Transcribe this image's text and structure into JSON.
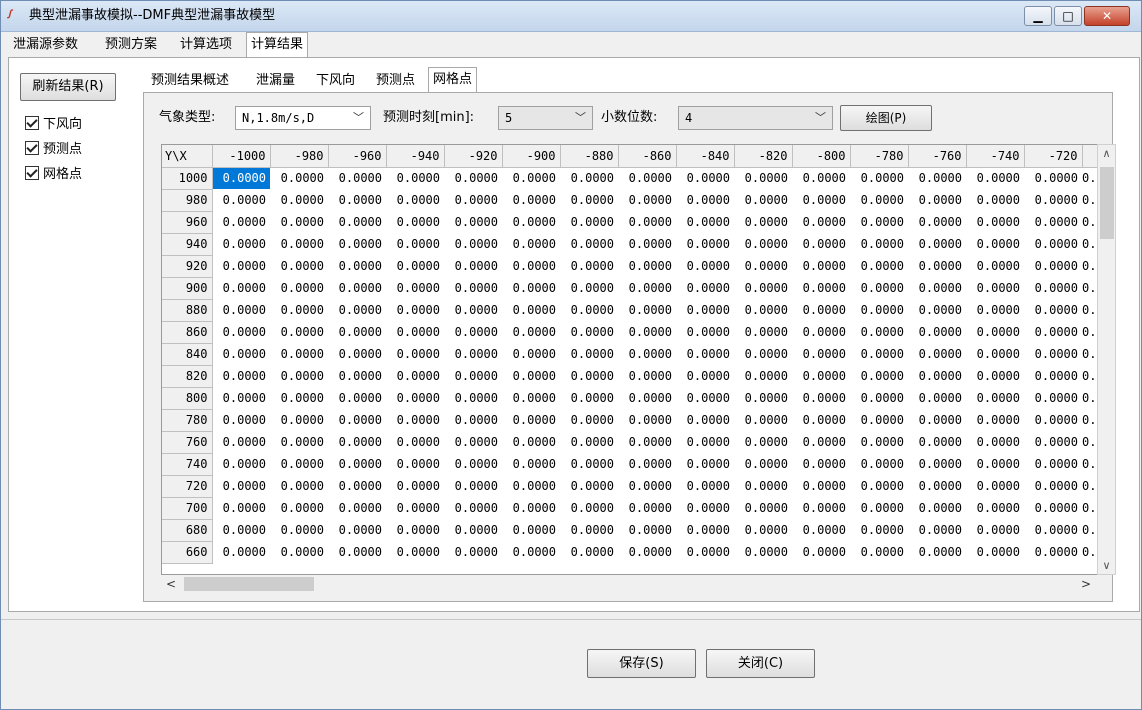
{
  "window": {
    "title": "典型泄漏事故模拟--DMF典型泄漏事故模型",
    "icon": "app-logo-icon",
    "controls": [
      "minimize-icon",
      "maximize-icon",
      "close-icon"
    ]
  },
  "top_tabs": [
    {
      "label": "泄漏源参数",
      "active": false
    },
    {
      "label": "预测方案",
      "active": false
    },
    {
      "label": "计算选项",
      "active": false
    },
    {
      "label": "计算结果",
      "active": true
    }
  ],
  "sidebar": {
    "refresh_label": "刷新结果(R)",
    "checkboxes": [
      {
        "label": "下风向",
        "checked": true
      },
      {
        "label": "预测点",
        "checked": true
      },
      {
        "label": "网格点",
        "checked": true
      }
    ]
  },
  "sub_tabs": [
    {
      "label": "预测结果概述",
      "active": false
    },
    {
      "label": "泄漏量",
      "active": false
    },
    {
      "label": "下风向",
      "active": false
    },
    {
      "label": "预测点",
      "active": false
    },
    {
      "label": "网格点",
      "active": true
    }
  ],
  "controls": {
    "weather_label": "气象类型:",
    "weather_value": "N,1.8m/s,D",
    "time_label": "预测时刻[min]:",
    "time_value": "5",
    "decimals_label": "小数位数:",
    "decimals_value": "4",
    "draw_label": "绘图(P)"
  },
  "grid": {
    "corner": "Y\\X",
    "columns": [
      "-1000",
      "-980",
      "-960",
      "-940",
      "-920",
      "-900",
      "-880",
      "-860",
      "-840",
      "-820",
      "-800",
      "-780",
      "-760",
      "-740",
      "-720",
      ""
    ],
    "rows": [
      "1000",
      "980",
      "960",
      "940",
      "920",
      "900",
      "880",
      "860",
      "840",
      "820",
      "800",
      "780",
      "760",
      "740",
      "720",
      "700",
      "680",
      "660"
    ],
    "cell_value": "0.0000",
    "truncated_cell": "0."
  },
  "footer": {
    "save_label": "保存(S)",
    "close_label": "关闭(C)"
  }
}
